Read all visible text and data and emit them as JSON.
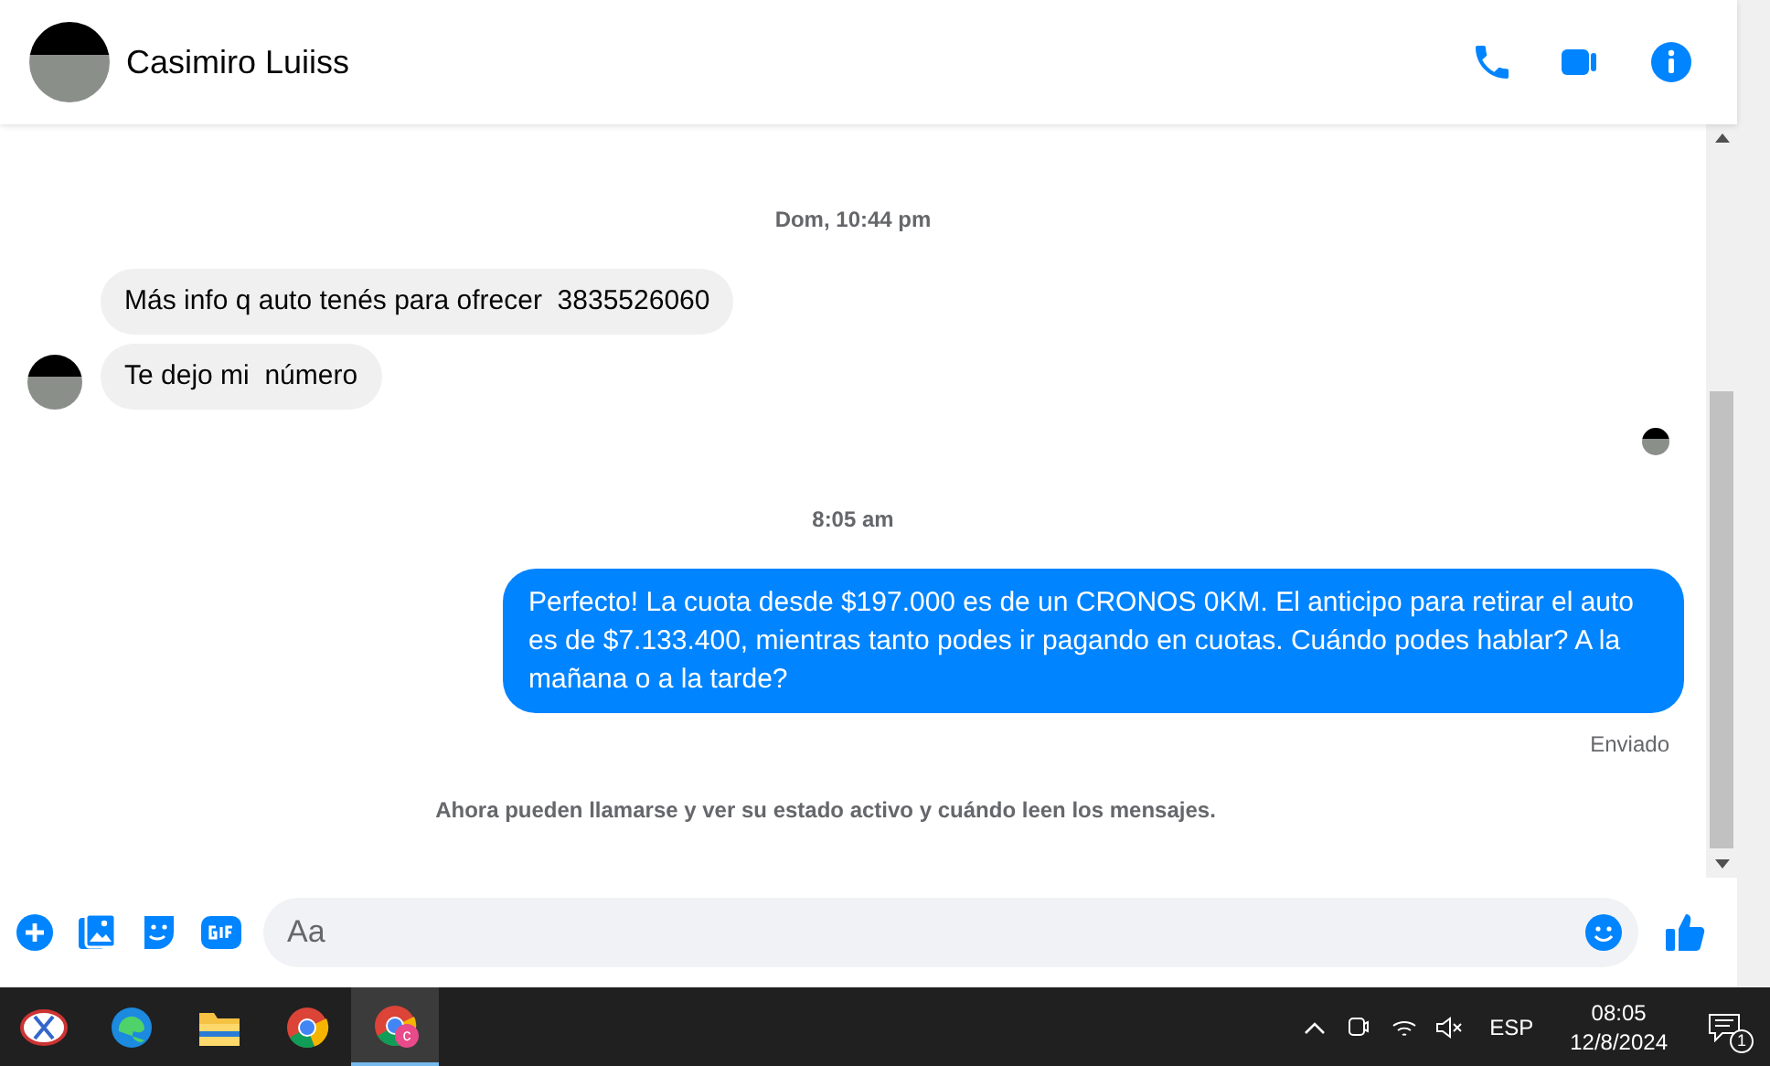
{
  "header": {
    "name": "Casimiro Luiiss"
  },
  "messages": [
    {
      "kind": "timestamp",
      "text": "Dom, 10:44 pm"
    },
    {
      "kind": "incoming_group",
      "bubbles": [
        "Más info q auto tenés para ofrecer  3835526060",
        "Te dejo mi  número"
      ]
    },
    {
      "kind": "seen"
    },
    {
      "kind": "timestamp",
      "text": "8:05 am"
    },
    {
      "kind": "outgoing",
      "text": "Perfecto! La cuota desde $197.000 es de un CRONOS 0KM. El anticipo para retirar el auto es de $7.133.400, mientras tanto podes ir pagando en cuotas. Cuándo podes hablar? A la mañana o a la tarde?"
    },
    {
      "kind": "status",
      "text": "Enviado"
    },
    {
      "kind": "notice",
      "text": "Ahora pueden llamarse y ver su estado activo y cuándo leen los mensajes."
    }
  ],
  "composer": {
    "placeholder": "Aa"
  },
  "taskbar": {
    "apps": [
      {
        "kind": "snip",
        "selected": false
      },
      {
        "kind": "edge",
        "selected": false
      },
      {
        "kind": "folder",
        "selected": false
      },
      {
        "kind": "chrome",
        "selected": false
      },
      {
        "kind": "chrome_profile",
        "selected": true,
        "badge": "c"
      }
    ],
    "language": "ESP",
    "time": "08:05",
    "date": "12/8/2024",
    "notifications": "1"
  }
}
